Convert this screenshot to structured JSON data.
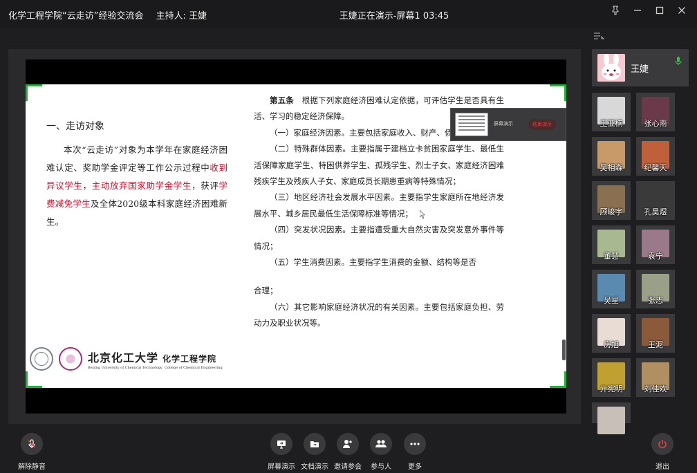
{
  "window": {
    "meeting_title": "化学工程学院“云走访”经验交流会",
    "host_label": "主持人: 王婕",
    "presenting_status": "王婕正在演示-屏幕1 03:45"
  },
  "slide": {
    "section_title": "一、走访对象",
    "left_para": {
      "t1": "本次“云走访”对象为本学年在家庭经济困难认定、奖助学金评定等工作公示过程中",
      "r1": "收到异议学生",
      "t2": "，",
      "r2": "主动放弃国家助学金学生",
      "t3": "，获评",
      "r3": "学费减免学生",
      "t4": "及全体2020级本科家庭经济困难新生。"
    },
    "logo": {
      "university_cn": "北京化工大学",
      "college_cn": "化学工程学院",
      "university_en": "Beijing University of Chemical Technology",
      "college_en": "College of Chemical Engineering"
    },
    "right": {
      "article_head": "第五条",
      "article_body": "根据下列家庭经济困难认定依据，可评估学生是否具有生活、学习的稳定经济保障。",
      "item1": "（一）家庭经济因素。主要包括家庭收入、财产、债务等情况；",
      "item2": "（二）特殊群体因素。主要指属于建档立卡贫困家庭学生、最低生活保障家庭学生、特困供养学生、孤残学生、烈士子女、家庭经济困难残疾学生及残疾人子女、家庭成员长期患重病等特殊情况；",
      "item3": "（三）地区经济社会发展水平因素。主要指学生家庭所在地经济发展水平、城乡居民最低生活保障标准等情况；",
      "item4": "（四）突发状况因素。主要指遭受重大自然灾害及突发意外事件等情况；",
      "item5": "（五）学生消费因素。主要指学生消费的金额、结构等是否",
      "item5b": "合理；",
      "item6": "（六）其它影响家庭经济状况的有关因素。主要包括家庭负担、劳动力及职业状况等。"
    }
  },
  "share_popup": {
    "label": "屏幕演示",
    "stop": "结束演示"
  },
  "host": {
    "name": "王婕"
  },
  "participants": [
    {
      "name": "王亚楠",
      "color": "#d8d8d8"
    },
    {
      "name": "张心雨",
      "color": "#6b3a4a"
    },
    {
      "name": "吴相森",
      "color": "#c89a6a"
    },
    {
      "name": "纪馨天",
      "color": "#c0603a"
    },
    {
      "name": "顾峻宇",
      "color": "#8a7050"
    },
    {
      "name": "孔昊煜",
      "color": "#3a3a3a"
    },
    {
      "name": "董慧",
      "color": "#a8b890"
    },
    {
      "name": "袁宁",
      "color": "#9a7a8a"
    },
    {
      "name": "吴星",
      "color": "#5a8ab0"
    },
    {
      "name": "张志",
      "color": "#9aa088"
    },
    {
      "name": "房旭",
      "color": "#e8dcd4"
    },
    {
      "name": "王泥",
      "color": "#8a5a3a"
    },
    {
      "name": "亓宪明",
      "color": "#c0a030"
    },
    {
      "name": "刘佳欢",
      "color": "#b09060"
    },
    {
      "name": "",
      "color": "#c8c0b8"
    }
  ],
  "toolbar": {
    "mute": "解除静音",
    "screen_share": "屏幕演示",
    "doc_share": "文档演示",
    "invite": "邀请参会",
    "participants": "参与人",
    "more": "更多",
    "leave": "退出"
  }
}
